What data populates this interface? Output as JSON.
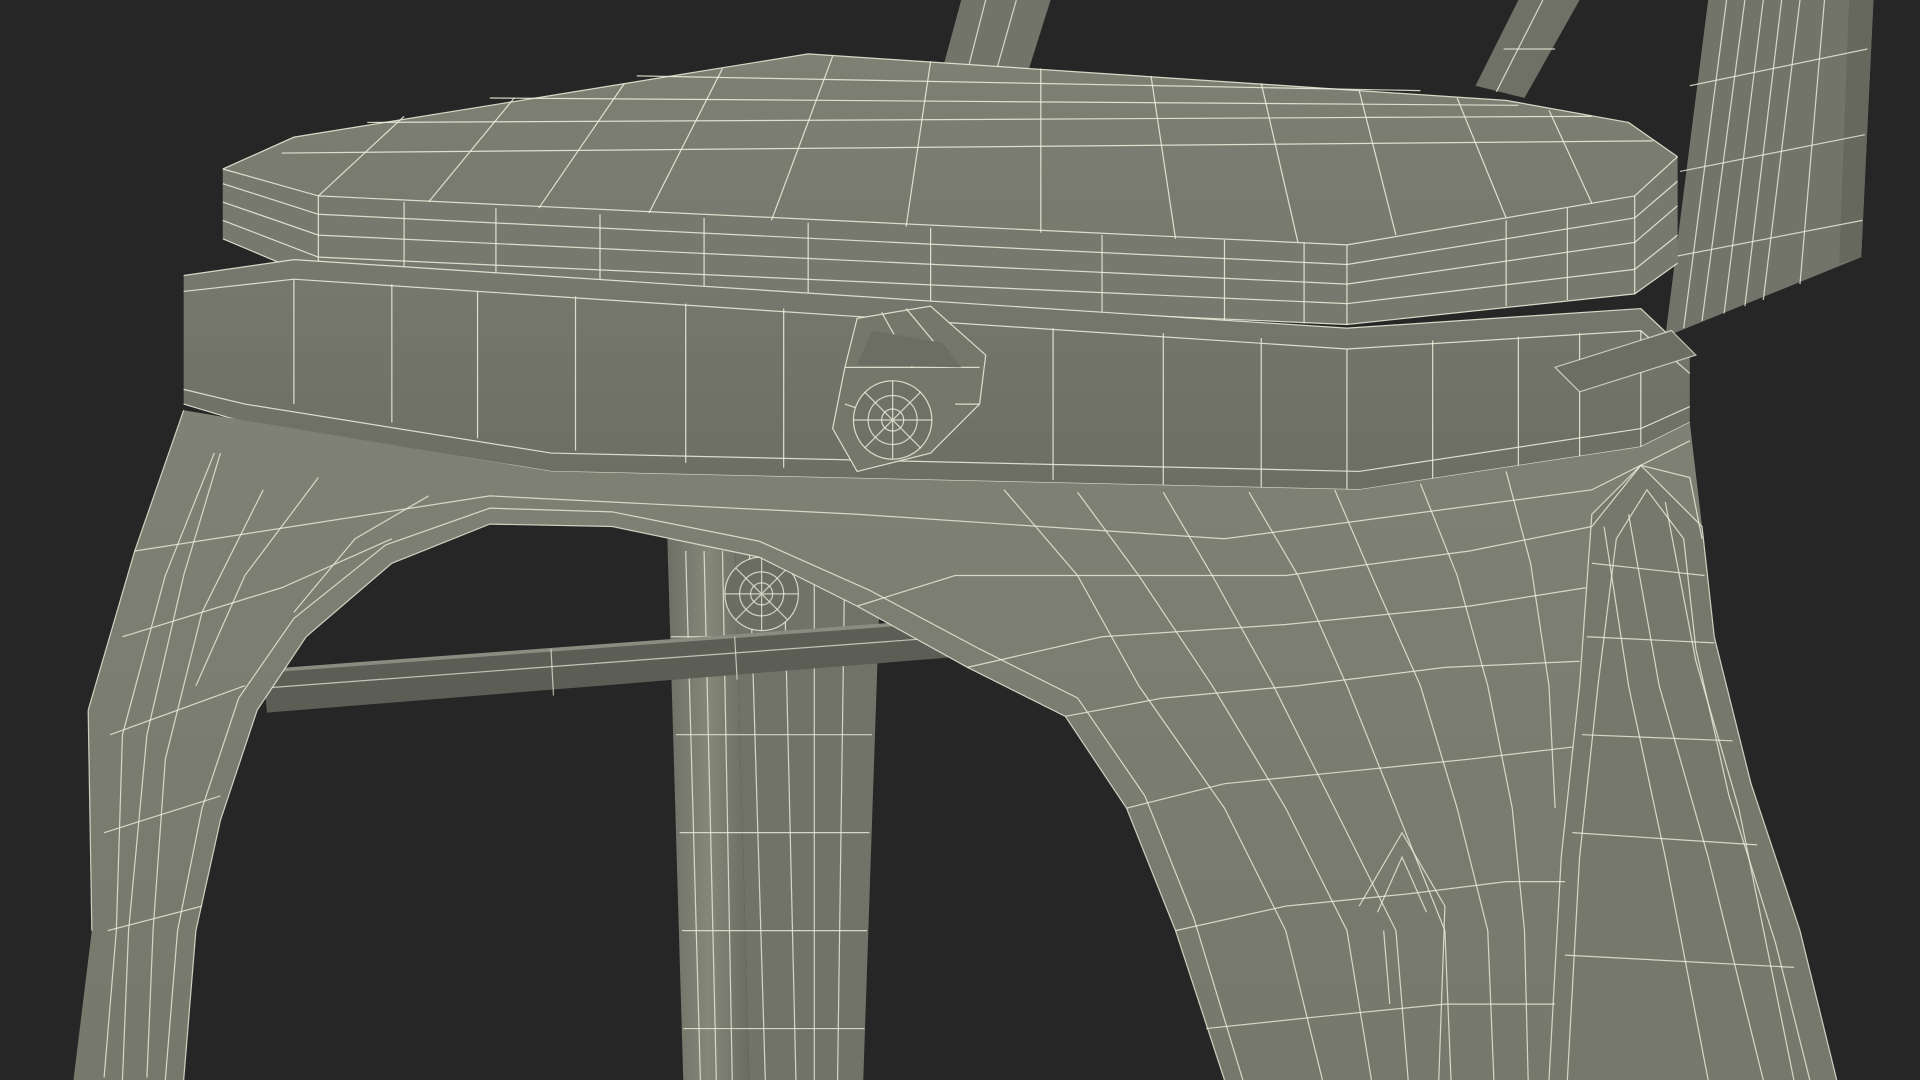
{
  "scene": {
    "subject": "chair-wireframe-model",
    "colors": {
      "background": "#262626",
      "surface": "#7c7e72",
      "surface_dark": "#63655b",
      "surface_shadow": "#4e5049",
      "surface_light": "#8c8e82",
      "wire": "#eeeedc",
      "wire_opacity": "0.85"
    }
  }
}
